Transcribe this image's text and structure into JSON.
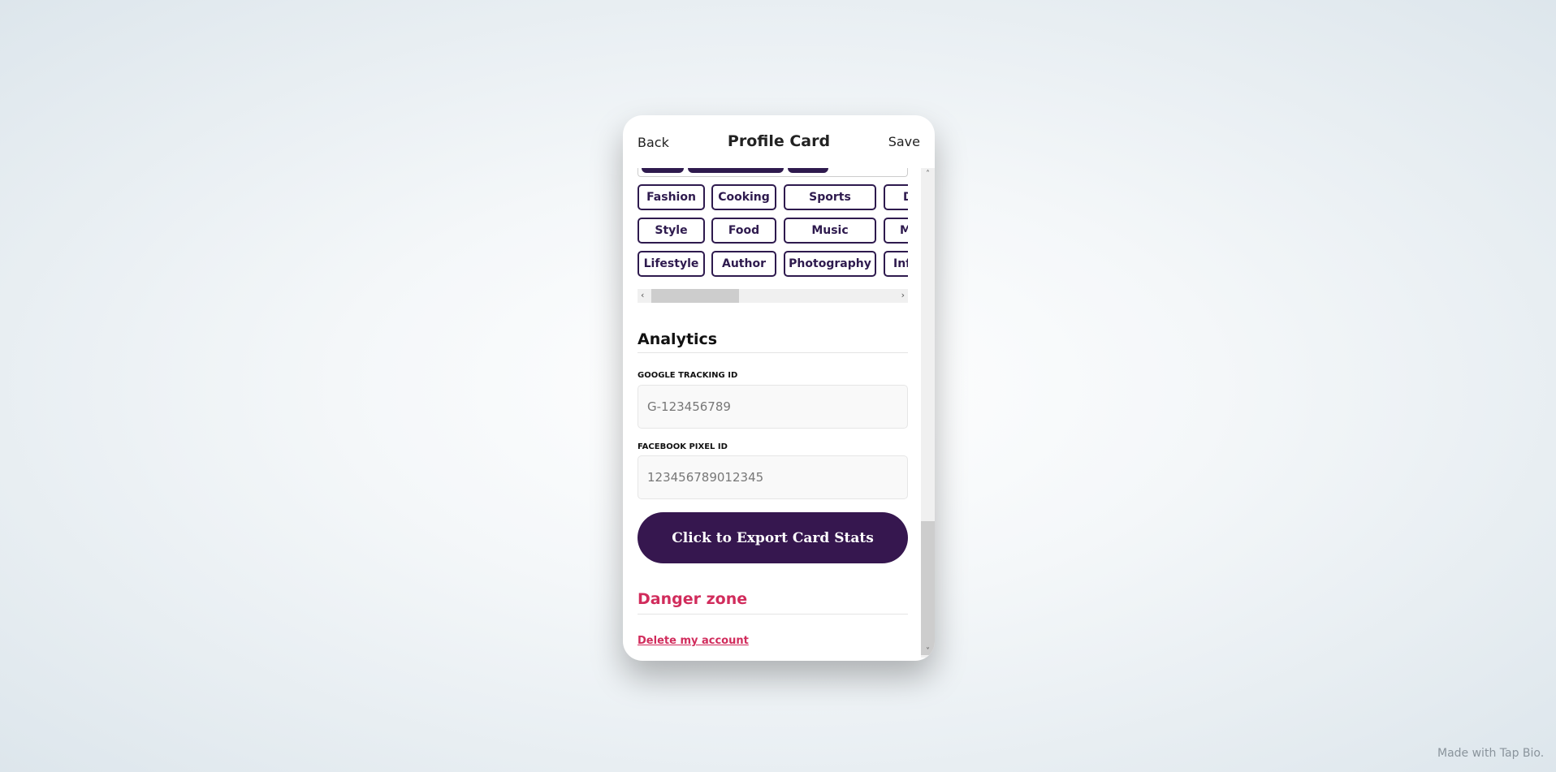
{
  "header": {
    "back_label": "Back",
    "title": "Profile Card",
    "save_label": "Save"
  },
  "tags": {
    "rows": [
      [
        "Fashion",
        "Cooking",
        "Sports",
        "D"
      ],
      [
        "Style",
        "Food",
        "Music",
        "M"
      ],
      [
        "Lifestyle",
        "Author",
        "Photography",
        "Inf"
      ]
    ]
  },
  "analytics": {
    "heading": "Analytics",
    "google_label": "GOOGLE TRACKING ID",
    "google_placeholder": "G-123456789",
    "facebook_label": "FACEBOOK PIXEL ID",
    "facebook_placeholder": "123456789012345",
    "export_label": "Click to Export Card Stats"
  },
  "danger": {
    "heading": "Danger zone",
    "delete_label": "Delete my account"
  },
  "footer": {
    "text": "Made with Tap Bio."
  },
  "colors": {
    "brand": "#36174f",
    "danger": "#d12c5c"
  }
}
